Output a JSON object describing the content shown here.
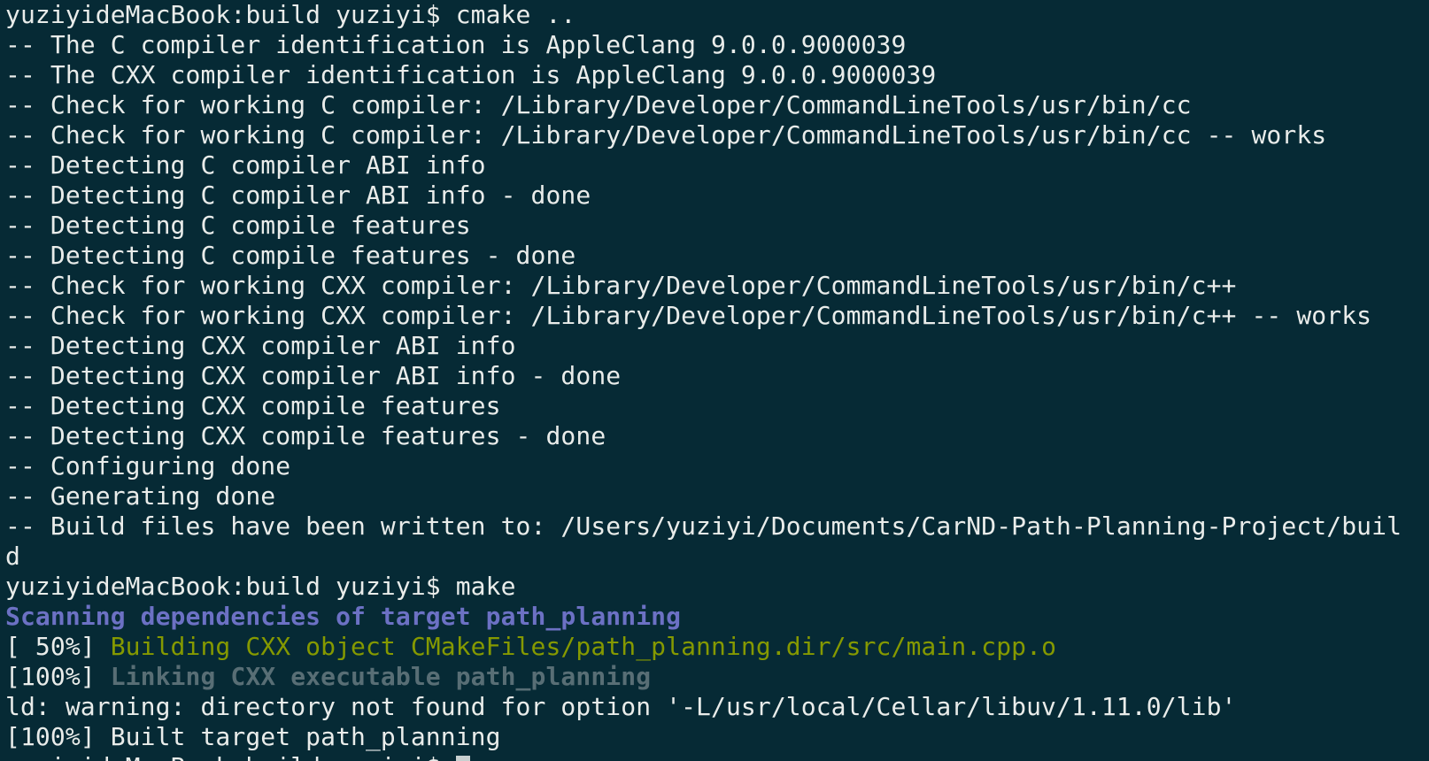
{
  "terminal": {
    "background": "#062a35",
    "lines": [
      "yuziyideMacBook:build yuziyi$ cmake ..",
      "-- The C compiler identification is AppleClang 9.0.0.9000039",
      "-- The CXX compiler identification is AppleClang 9.0.0.9000039",
      "-- Check for working C compiler: /Library/Developer/CommandLineTools/usr/bin/cc",
      "-- Check for working C compiler: /Library/Developer/CommandLineTools/usr/bin/cc -- works",
      "-- Detecting C compiler ABI info",
      "-- Detecting C compiler ABI info - done",
      "-- Detecting C compile features",
      "-- Detecting C compile features - done",
      "-- Check for working CXX compiler: /Library/Developer/CommandLineTools/usr/bin/c++",
      "-- Check for working CXX compiler: /Library/Developer/CommandLineTools/usr/bin/c++ -- works",
      "-- Detecting CXX compiler ABI info",
      "-- Detecting CXX compiler ABI info - done",
      "-- Detecting CXX compile features",
      "-- Detecting CXX compile features - done",
      "-- Configuring done",
      "-- Generating done",
      "-- Build files have been written to: /Users/yuziyi/Documents/CarND-Path-Planning-Project/buil",
      "d",
      "yuziyideMacBook:build yuziyi$ make"
    ],
    "scanning_line": "Scanning dependencies of target path_planning",
    "build_line": {
      "prefix": "[ 50%] ",
      "text": "Building CXX object CMakeFiles/path_planning.dir/src/main.cpp.o"
    },
    "link_line": {
      "prefix": "[100%] ",
      "text": "Linking CXX executable path_planning"
    },
    "warning_line": "ld: warning: directory not found for option '-L/usr/local/Cellar/libuv/1.11.0/lib'",
    "built_line": "[100%] Built target path_planning",
    "prompt_line": "yuziyideMacBook:build yuziyi$ ",
    "colors": {
      "text": "#e9ecea",
      "scanning": "#6c71c4",
      "building": "#859900",
      "linking": "#586e75",
      "cursor": "#c8d0d0"
    }
  }
}
